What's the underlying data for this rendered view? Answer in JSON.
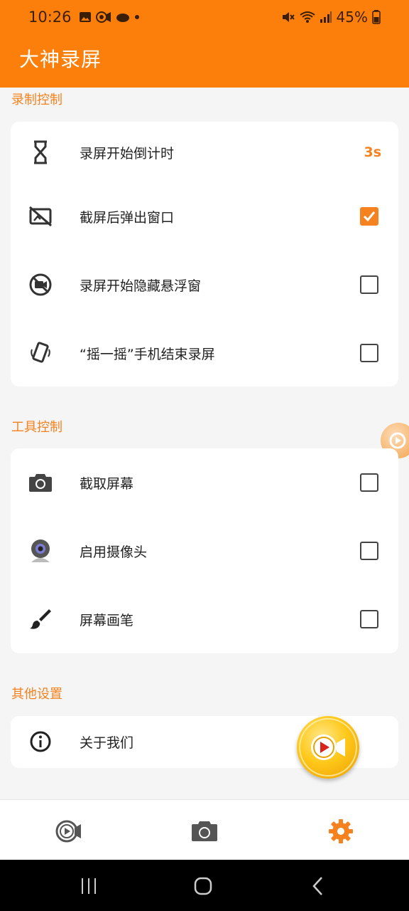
{
  "status_bar": {
    "time": "10:26",
    "battery": "45%"
  },
  "app_title": "大神录屏",
  "sections": {
    "recording": {
      "title": "录制控制",
      "items": [
        {
          "label": "录屏开始倒计时",
          "value": "3s",
          "icon": "hourglass-icon"
        },
        {
          "label": "截屏后弹出窗口",
          "checked": true,
          "icon": "screenshot-off-icon"
        },
        {
          "label": "录屏开始隐藏悬浮窗",
          "checked": false,
          "icon": "video-off-icon"
        },
        {
          "label": "“摇一摇”手机结束录屏",
          "checked": false,
          "icon": "shake-phone-icon"
        }
      ]
    },
    "tools": {
      "title": "工具控制",
      "items": [
        {
          "label": "截取屏幕",
          "checked": false,
          "icon": "camera-icon"
        },
        {
          "label": "启用摄像头",
          "checked": false,
          "icon": "webcam-icon"
        },
        {
          "label": "屏幕画笔",
          "checked": false,
          "icon": "brush-icon"
        }
      ]
    },
    "other": {
      "title": "其他设置",
      "items": [
        {
          "label": "关于我们",
          "icon": "info-icon"
        }
      ]
    }
  },
  "bottom_nav": {
    "items": [
      {
        "name": "record",
        "icon": "record-video-icon",
        "active": false
      },
      {
        "name": "screenshot",
        "icon": "camera-icon",
        "active": false
      },
      {
        "name": "settings",
        "icon": "gear-icon",
        "active": true
      }
    ]
  },
  "colors": {
    "accent": "#fb7f0a",
    "section_title": "#f5821f",
    "background": "#f5f5f5"
  }
}
